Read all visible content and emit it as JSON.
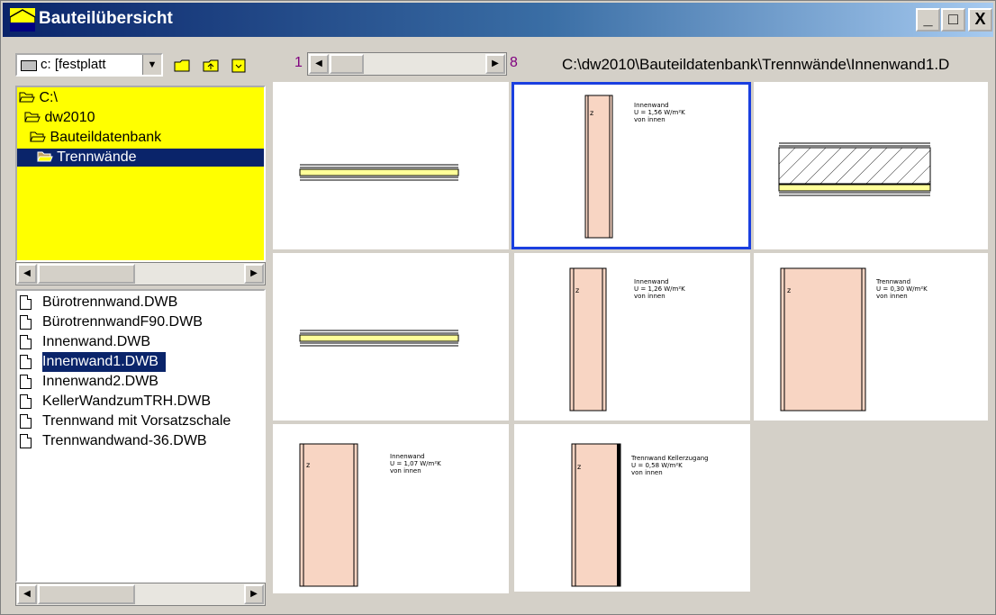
{
  "window": {
    "title": "Bauteilübersicht",
    "controls": {
      "minimize": "_",
      "maximize": "□",
      "close": "X"
    }
  },
  "drive": {
    "label": "c: [festplatt"
  },
  "tree": {
    "items": [
      {
        "label": "C:\\",
        "selected": false
      },
      {
        "label": "dw2010",
        "selected": false
      },
      {
        "label": "Bauteildatenbank",
        "selected": false
      },
      {
        "label": "Trennwände",
        "selected": true
      }
    ]
  },
  "files": {
    "items": [
      {
        "label": "Bürotrennwand.DWB",
        "selected": false
      },
      {
        "label": "BürotrennwandF90.DWB",
        "selected": false
      },
      {
        "label": "Innenwand.DWB",
        "selected": false
      },
      {
        "label": "Innenwand1.DWB",
        "selected": true
      },
      {
        "label": "Innenwand2.DWB",
        "selected": false
      },
      {
        "label": "KellerWandzumTRH.DWB",
        "selected": false
      },
      {
        "label": "Trennwand mit Vorsatzschale",
        "selected": false
      },
      {
        "label": "Trennwandwand-36.DWB",
        "selected": false
      }
    ]
  },
  "pager": {
    "first": "1",
    "last": "8"
  },
  "path": "C:\\dw2010\\Bauteildatenbank\\Trennwände\\Innenwand1.D",
  "thumbnails": [
    {
      "type": "horizontal"
    },
    {
      "type": "vertical",
      "z": "z",
      "lines": [
        "Innenwand",
        "U = 1,56 W/m²K",
        "von innen"
      ],
      "selected": true
    },
    {
      "type": "hatched"
    },
    {
      "type": "horizontal"
    },
    {
      "type": "vertical",
      "z": "z",
      "lines": [
        "Innenwand",
        "U = 1,26 W/m²K",
        "von innen"
      ]
    },
    {
      "type": "vertical-wide",
      "z": "z",
      "lines": [
        "Trennwand",
        "U = 0,30 W/m²K",
        "von innen"
      ]
    },
    {
      "type": "vertical",
      "z": "z",
      "lines": [
        "Innenwand",
        "U = 1,07 W/m²K",
        "von innen"
      ]
    },
    {
      "type": "vertical",
      "z": "z",
      "lines": [
        "Trennwand Kellerzugang",
        "U = 0,58 W/m²K",
        "von innen"
      ]
    }
  ],
  "colors": {
    "selection": "#0a246a",
    "tree_bg": "#ffff00",
    "wall_fill": "#f8d5c3",
    "insulation": "#ffff99",
    "thumb_select": "#1a3fe0"
  }
}
